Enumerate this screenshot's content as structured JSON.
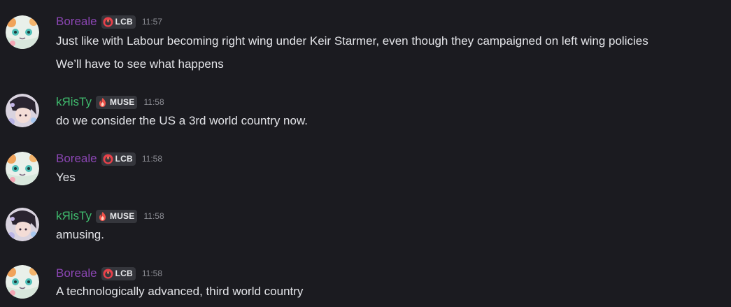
{
  "messages": [
    {
      "author": "Boreale",
      "author_color": "#8b46b3",
      "tag": "LCB",
      "tag_icon": "flame-ring-icon",
      "time": "11:57",
      "lines": [
        "Just like with Labour becoming right wing under Keir Starmer, even though they campaigned on left wing policies",
        "We’ll have to see what happens"
      ]
    },
    {
      "author": "kЯisTy",
      "author_color": "#3fba6d",
      "tag": "MUSE",
      "tag_icon": "flame-icon",
      "time": "11:58",
      "lines": [
        "do we consider the US a 3rd world country now."
      ]
    },
    {
      "author": "Boreale",
      "author_color": "#8b46b3",
      "tag": "LCB",
      "tag_icon": "flame-ring-icon",
      "time": "11:58",
      "lines": [
        "Yes"
      ]
    },
    {
      "author": "kЯisTy",
      "author_color": "#3fba6d",
      "tag": "MUSE",
      "tag_icon": "flame-icon",
      "time": "11:58",
      "lines": [
        "amusing."
      ]
    },
    {
      "author": "Boreale",
      "author_color": "#8b46b3",
      "tag": "LCB",
      "tag_icon": "flame-ring-icon",
      "time": "11:58",
      "lines": [
        "A technologically advanced, third world country"
      ]
    }
  ]
}
